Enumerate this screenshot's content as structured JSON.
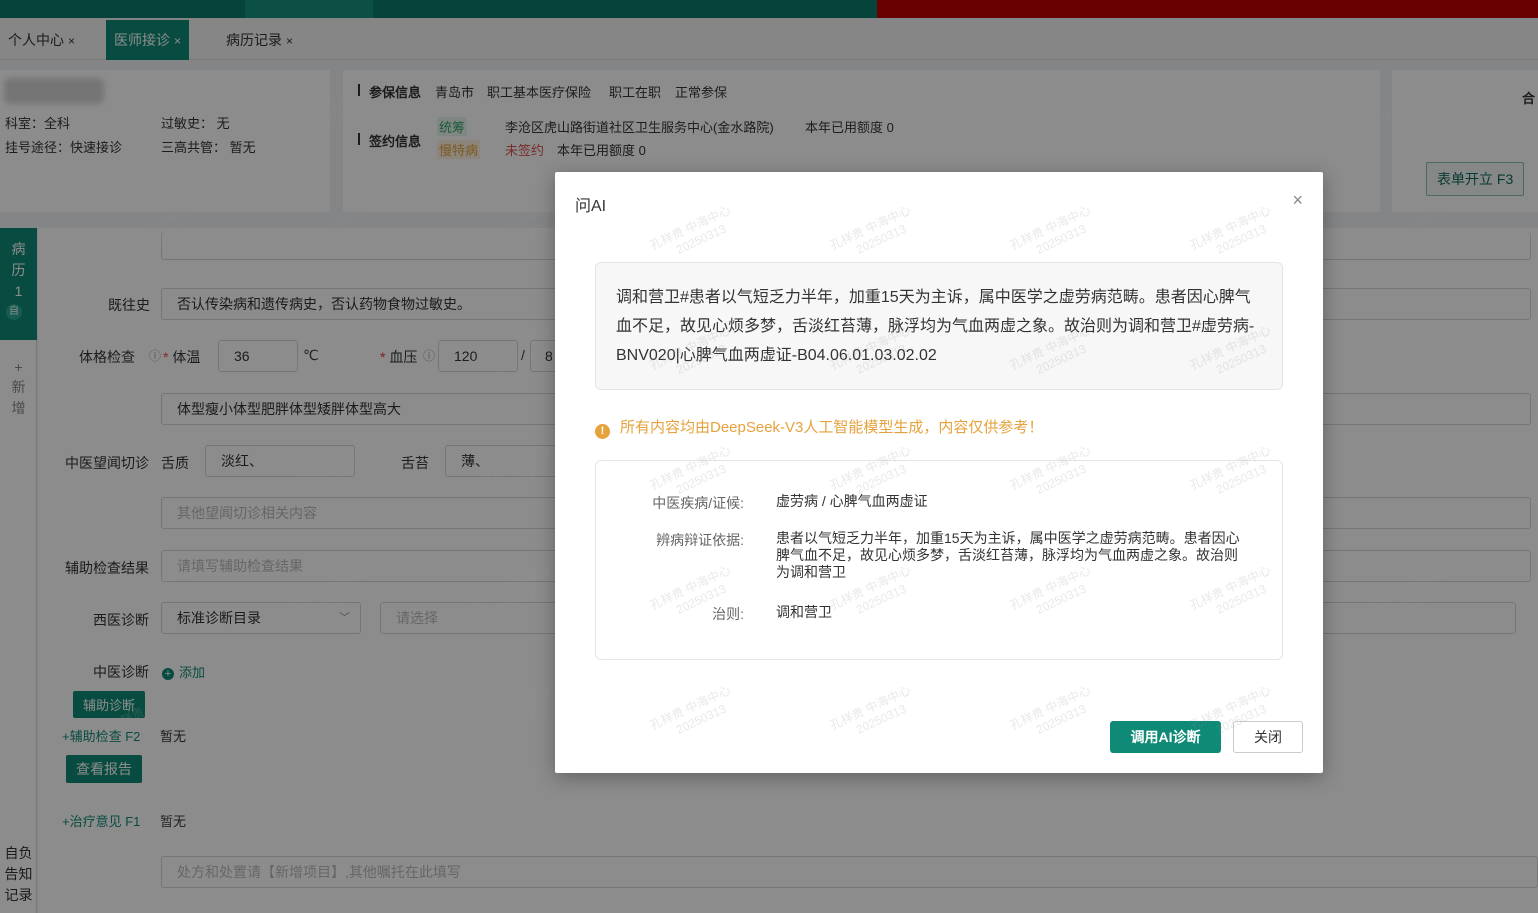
{
  "tabs": [
    {
      "label": "个人中心",
      "close": "×"
    },
    {
      "label": "医师接诊",
      "close": "×"
    },
    {
      "label": "病历记录",
      "close": "×"
    }
  ],
  "patient": {
    "dept": "科室：全科",
    "allergy": "过敏史：  无",
    "route": "挂号途径：快速接诊",
    "sangao": "三高共管：  暂无"
  },
  "insurance": {
    "label": "参保信息",
    "city": "青岛市",
    "type": "职工基本医疗保险",
    "status1": "职工在职",
    "status2": "正常参保"
  },
  "signing": {
    "label": "签约信息",
    "tag1": "统筹",
    "tag2": "慢特病",
    "org": "李沧区虎山路街道社区卫生服务中心(金水路院)",
    "quota1": "本年已用额度 0",
    "unsigned": "未签约",
    "quota2": "本年已用额度 0"
  },
  "right_panel": {
    "btn": "表单开立 F3",
    "partial": "合"
  },
  "sidebar": {
    "active_chars": [
      "病",
      "历",
      "1"
    ],
    "badge": "自",
    "add_chars": [
      "+",
      "新",
      "增"
    ],
    "bottom_chars": [
      "自负",
      "告知",
      "记录"
    ]
  },
  "form": {
    "past_history_label": "既往史",
    "past_history_value": "否认传染病和遗传病史，否认药物食物过敏史。",
    "physical_label": "体格检查",
    "temp_label": "体温",
    "temp_value": "36",
    "temp_unit": "℃",
    "bp_label": "血压",
    "bp_value": "120",
    "bp_sep": "/",
    "bp_value2": "8",
    "body_type": "体型瘦小体型肥胖体型矮胖体型高大",
    "tcm_look_label": "中医望闻切诊",
    "tongue_label": "舌质",
    "tongue_value": "淡红、",
    "coating_label": "舌苔",
    "coating_value": "薄、",
    "other_placeholder": "其他望闻切诊相关内容",
    "aux_label": "辅助检查结果",
    "aux_placeholder": "请填写辅助检查结果",
    "western_label": "西医诊断",
    "western_select": "标准诊断目录",
    "western_placeholder": "请选择",
    "tcm_diag_label": "中医诊断",
    "add_link": "添加",
    "assist_btn": "辅助诊断",
    "aux_exam_link": "+辅助检查 F2",
    "aux_exam_value": "暂无",
    "report_btn": "查看报告",
    "treatment_link": "+治疗意见 F1",
    "treatment_value": "暂无",
    "prescription_placeholder": "处方和处置请【新增项目】,其他嘱托在此填写"
  },
  "modal": {
    "title": "问AI",
    "close": "×",
    "ai_text": "调和营卫#患者以气短乏力半年，加重15天为主诉，属中医学之虚劳病范畴。患者因心脾气血不足，故见心烦多梦，舌淡红苔薄，脉浮均为气血两虚之象。故治则为调和营卫#虚劳病-BNV020|心脾气血两虚证-B04.06.01.03.02.02",
    "warning": "所有内容均由DeepSeek-V3人工智能模型生成，内容仅供参考！",
    "rows": [
      {
        "label": "中医疾病/证候:",
        "value": "虚劳病 / 心脾气血两虚证"
      },
      {
        "label": "辨病辩证依据:",
        "value": "患者以气短乏力半年，加重15天为主诉，属中医学之虚劳病范畴。患者因心脾气血不足，故见心烦多梦，舌淡红苔薄，脉浮均为气血两虚之象。故治则为调和营卫"
      },
      {
        "label": "治则:",
        "value": "调和营卫"
      }
    ],
    "primary_btn": "调用AI诊断",
    "close_btn": "关闭"
  },
  "watermark": {
    "name": "孔祥贵 中海中心",
    "date": "20250313"
  },
  "colors": {
    "primary": "#0f8a77",
    "warning": "#e6a23c",
    "alert_bar": "#c00000"
  }
}
